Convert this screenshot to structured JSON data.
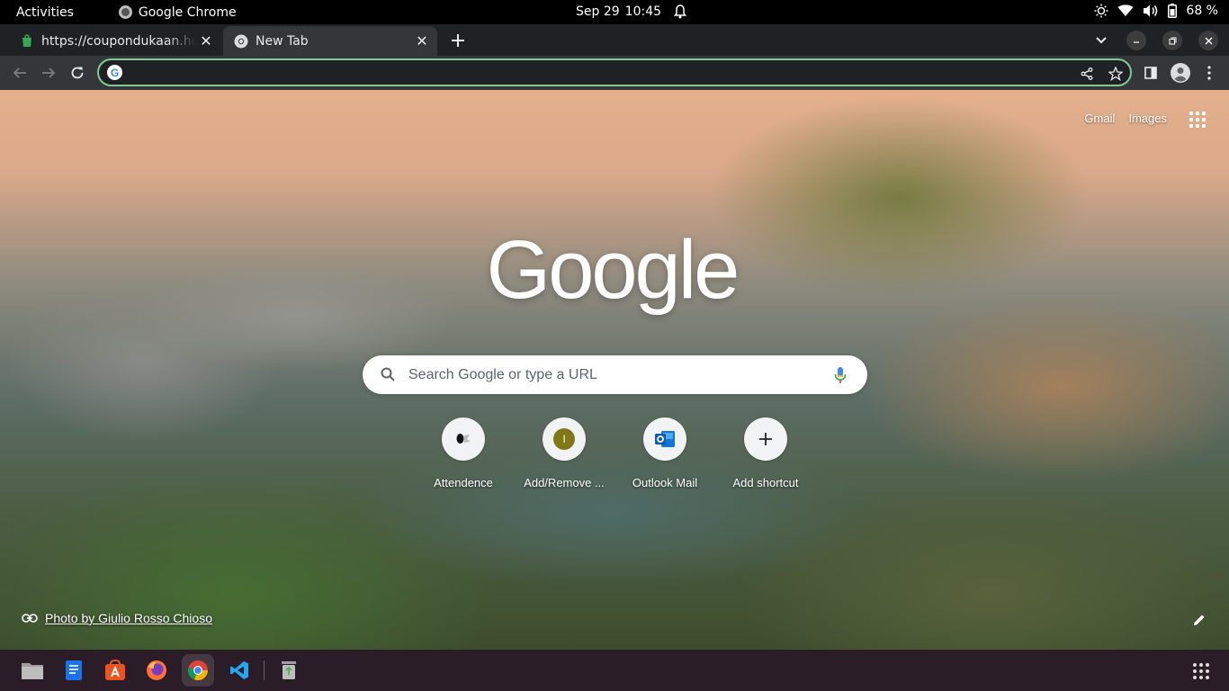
{
  "topbar": {
    "activities": "Activities",
    "app_name": "Google Chrome",
    "date": "Sep 29",
    "time": "10:45",
    "battery": "68 %"
  },
  "tabs": [
    {
      "title": "https://coupondukaan.he",
      "icon": "green-favicon",
      "active": false
    },
    {
      "title": "New Tab",
      "icon": "chrome-favicon",
      "active": true
    }
  ],
  "omnibox": {
    "value": "",
    "placeholder": ""
  },
  "ntp": {
    "links": {
      "gmail": "Gmail",
      "images": "Images"
    },
    "logo": "Google",
    "search_placeholder": "Search Google or type a URL",
    "shortcuts": [
      {
        "label": "Attendence",
        "icon": "attendence-favicon"
      },
      {
        "label": "Add/Remove ...",
        "icon": "letter-i-favicon",
        "letter": "I"
      },
      {
        "label": "Outlook Mail",
        "icon": "outlook-icon"
      },
      {
        "label": "Add shortcut",
        "icon": "plus-icon"
      }
    ],
    "attribution": "Photo by Giulio Rosso Chioso"
  },
  "dock": [
    "files-icon",
    "text-editor-icon",
    "software-center-icon",
    "firefox-icon",
    "chrome-icon",
    "vscode-icon",
    "trash-icon",
    "show-apps-icon"
  ],
  "colors": {
    "omnibox_focus": "#81c995",
    "tab_active": "#35363a",
    "tabstrip": "#202124",
    "dock": "#2b1d27"
  }
}
